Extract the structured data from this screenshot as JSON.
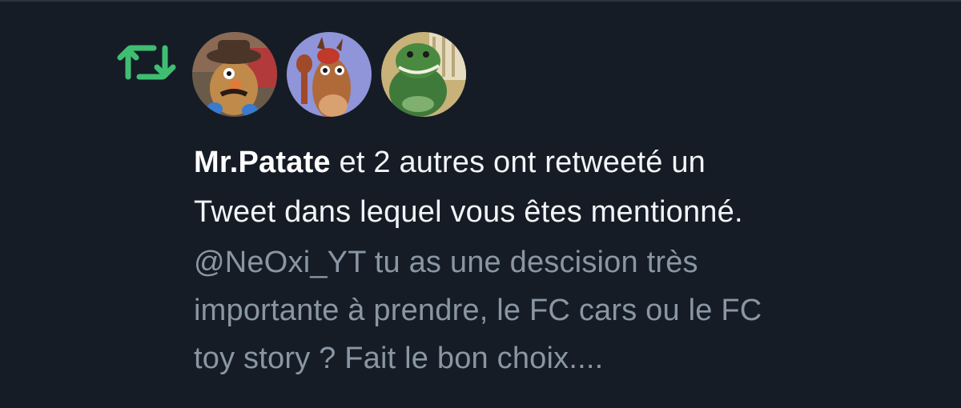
{
  "notification": {
    "type_icon": "retweet-icon",
    "accent_color": "#3fbe72",
    "avatars": [
      {
        "icon": "avatar-mr-patate"
      },
      {
        "icon": "avatar-horse"
      },
      {
        "icon": "avatar-dinosaur"
      }
    ],
    "username": "Mr.Patate",
    "message_line1": " et 2 autres ont retweeté un",
    "message_line2": "Tweet dans lequel vous êtes mentionné.",
    "tweet_text": {
      "line1": "@NeOxi_YT tu as une descision très",
      "line2": "importante à prendre, le FC cars ou le FC",
      "line3": "toy story ? Fait le bon choix...."
    }
  },
  "colors": {
    "background": "#151c26",
    "primary_text": "#f2f4f7",
    "secondary_text": "#8a96a3"
  }
}
